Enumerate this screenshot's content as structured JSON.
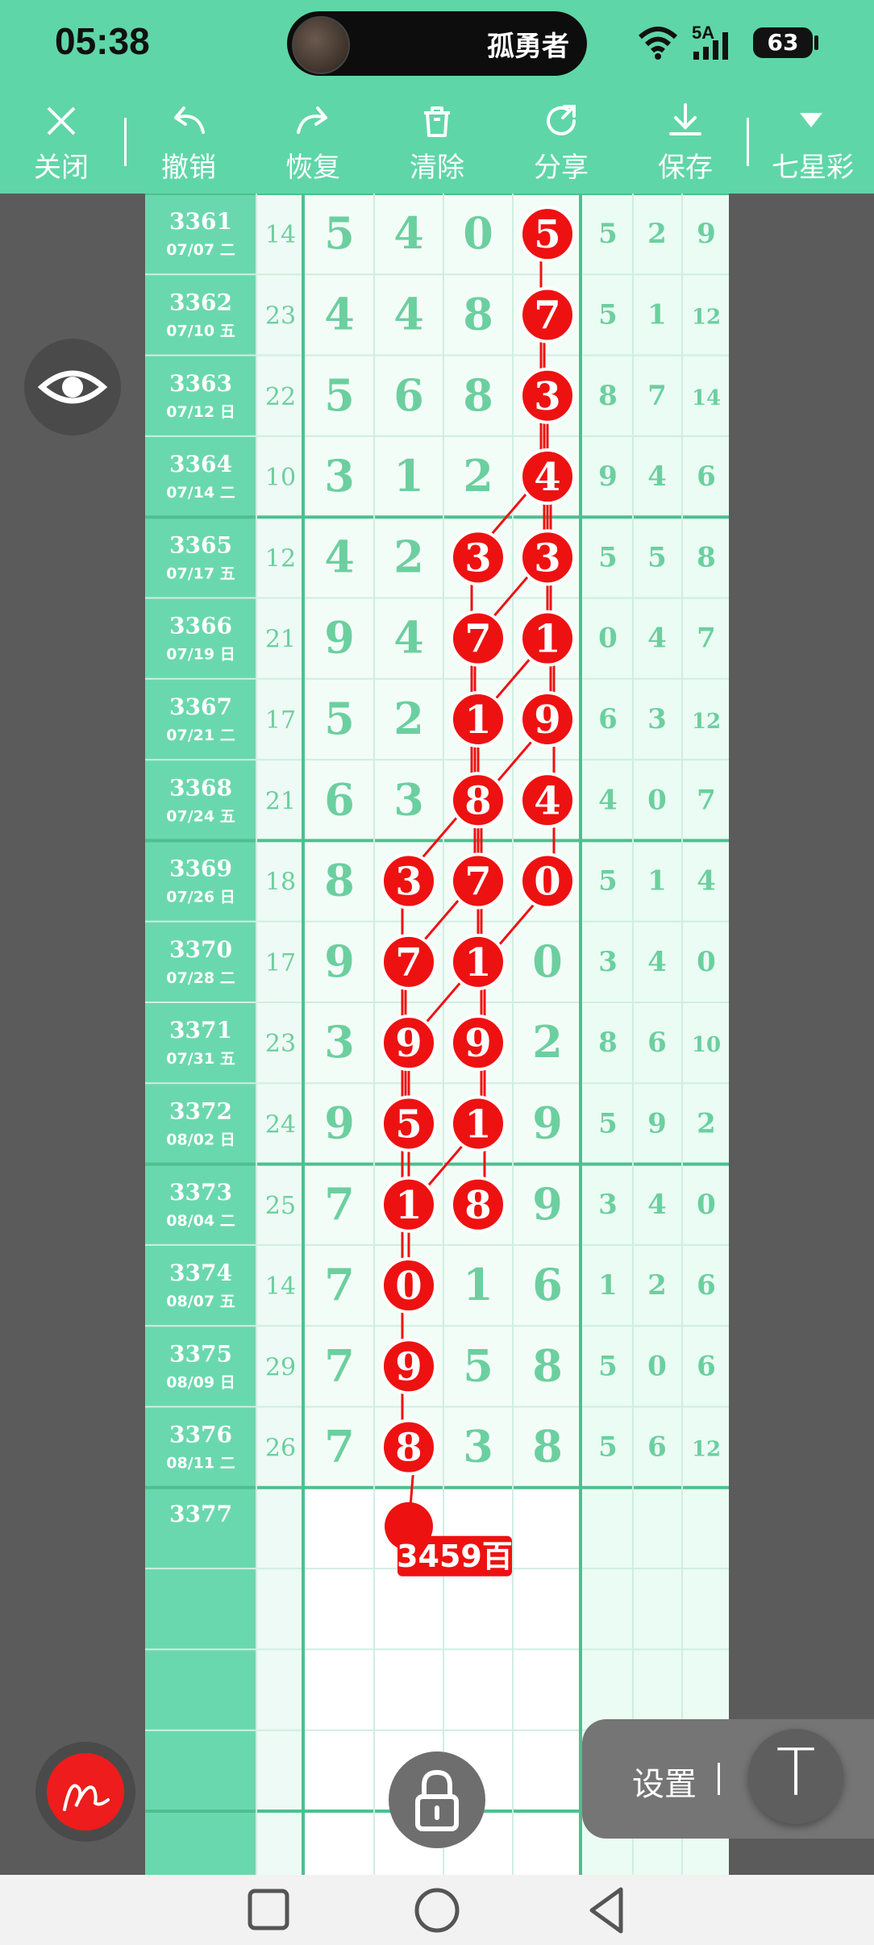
{
  "status_bar": {
    "time": "05:38",
    "now_playing_title": "孤勇者",
    "network": "5A",
    "battery": "63"
  },
  "toolbar": {
    "close_label": "关闭",
    "undo_label": "撤销",
    "redo_label": "恢复",
    "clear_label": "清除",
    "share_label": "分享",
    "save_label": "保存",
    "lottery_label": "七星彩"
  },
  "chart_grid": {
    "rows": [
      {
        "issue": "3361",
        "date": "07/07 二",
        "sum": "14",
        "a": "5",
        "b": "4",
        "c": "0",
        "d": "5",
        "e": "5",
        "f": "2",
        "g": "9"
      },
      {
        "issue": "3362",
        "date": "07/10 五",
        "sum": "23",
        "a": "4",
        "b": "4",
        "c": "8",
        "d": "7",
        "e": "5",
        "f": "1",
        "g": "12"
      },
      {
        "issue": "3363",
        "date": "07/12 日",
        "sum": "22",
        "a": "5",
        "b": "6",
        "c": "8",
        "d": "3",
        "e": "8",
        "f": "7",
        "g": "14"
      },
      {
        "issue": "3364",
        "date": "07/14 二",
        "sum": "10",
        "a": "3",
        "b": "1",
        "c": "2",
        "d": "4",
        "e": "9",
        "f": "4",
        "g": "6"
      },
      {
        "issue": "3365",
        "date": "07/17 五",
        "sum": "12",
        "a": "4",
        "b": "2",
        "c": "3",
        "d": "3",
        "e": "5",
        "f": "5",
        "g": "8"
      },
      {
        "issue": "3366",
        "date": "07/19 日",
        "sum": "21",
        "a": "9",
        "b": "4",
        "c": "7",
        "d": "1",
        "e": "0",
        "f": "4",
        "g": "7"
      },
      {
        "issue": "3367",
        "date": "07/21 二",
        "sum": "17",
        "a": "5",
        "b": "2",
        "c": "1",
        "d": "9",
        "e": "6",
        "f": "3",
        "g": "12"
      },
      {
        "issue": "3368",
        "date": "07/24 五",
        "sum": "21",
        "a": "6",
        "b": "3",
        "c": "8",
        "d": "4",
        "e": "4",
        "f": "0",
        "g": "7"
      },
      {
        "issue": "3369",
        "date": "07/26 日",
        "sum": "18",
        "a": "8",
        "b": "3",
        "c": "7",
        "d": "0",
        "e": "5",
        "f": "1",
        "g": "4"
      },
      {
        "issue": "3370",
        "date": "07/28 二",
        "sum": "17",
        "a": "9",
        "b": "7",
        "c": "1",
        "d": "0",
        "e": "3",
        "f": "4",
        "g": "0"
      },
      {
        "issue": "3371",
        "date": "07/31 五",
        "sum": "23",
        "a": "3",
        "b": "9",
        "c": "9",
        "d": "2",
        "e": "8",
        "f": "6",
        "g": "10"
      },
      {
        "issue": "3372",
        "date": "08/02 日",
        "sum": "24",
        "a": "9",
        "b": "5",
        "c": "1",
        "d": "9",
        "e": "5",
        "f": "9",
        "g": "2"
      },
      {
        "issue": "3373",
        "date": "08/04 二",
        "sum": "25",
        "a": "7",
        "b": "1",
        "c": "8",
        "d": "9",
        "e": "3",
        "f": "4",
        "g": "0"
      },
      {
        "issue": "3374",
        "date": "08/07 五",
        "sum": "14",
        "a": "7",
        "b": "0",
        "c": "1",
        "d": "6",
        "e": "1",
        "f": "2",
        "g": "6"
      },
      {
        "issue": "3375",
        "date": "08/09 日",
        "sum": "29",
        "a": "7",
        "b": "9",
        "c": "5",
        "d": "8",
        "e": "5",
        "f": "0",
        "g": "6"
      },
      {
        "issue": "3376",
        "date": "08/11 二",
        "sum": "26",
        "a": "7",
        "b": "8",
        "c": "3",
        "d": "8",
        "e": "5",
        "f": "6",
        "g": "12"
      }
    ],
    "next_issue": "3377",
    "annotation": "3459百",
    "circled": [
      {
        "row": 0,
        "col": "d"
      },
      {
        "row": 1,
        "col": "d"
      },
      {
        "row": 2,
        "col": "d"
      },
      {
        "row": 3,
        "col": "d"
      },
      {
        "row": 4,
        "col": "c"
      },
      {
        "row": 4,
        "col": "d"
      },
      {
        "row": 5,
        "col": "c"
      },
      {
        "row": 5,
        "col": "d"
      },
      {
        "row": 6,
        "col": "c"
      },
      {
        "row": 6,
        "col": "d"
      },
      {
        "row": 7,
        "col": "c"
      },
      {
        "row": 7,
        "col": "d"
      },
      {
        "row": 8,
        "col": "b"
      },
      {
        "row": 8,
        "col": "c"
      },
      {
        "row": 8,
        "col": "d"
      },
      {
        "row": 9,
        "col": "b"
      },
      {
        "row": 9,
        "col": "c"
      },
      {
        "row": 10,
        "col": "b"
      },
      {
        "row": 10,
        "col": "c"
      },
      {
        "row": 11,
        "col": "b"
      },
      {
        "row": 11,
        "col": "c"
      },
      {
        "row": 12,
        "col": "b"
      },
      {
        "row": 12,
        "col": "c"
      },
      {
        "row": 13,
        "col": "b"
      },
      {
        "row": 14,
        "col": "b"
      },
      {
        "row": 15,
        "col": "b"
      }
    ],
    "colors": {
      "accent": "#5fd6a8",
      "digit": "#6ccf9f",
      "mark": "#ee1111",
      "header_col": "#6ad8ae"
    }
  },
  "controls": {
    "settings_label": "设置",
    "text_tool_label": "T"
  }
}
